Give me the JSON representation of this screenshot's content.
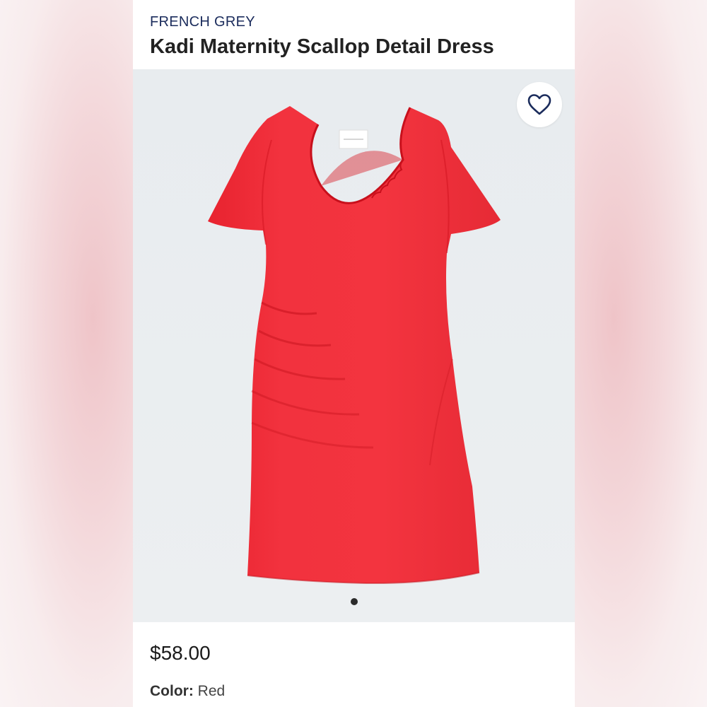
{
  "product": {
    "brand": "FRENCH GREY",
    "title": "Kadi Maternity Scallop Detail Dress",
    "price": "$58.00",
    "color_label": "Color:",
    "color_value": "Red",
    "image_subject": "red-short-sleeve-dress",
    "image_count": 1,
    "active_image": 1
  },
  "icons": {
    "favorite": "heart-outline-icon"
  },
  "colors": {
    "brand_text": "#1b2c5c",
    "dress": "#f0303f",
    "image_background": "#e9edf0"
  }
}
